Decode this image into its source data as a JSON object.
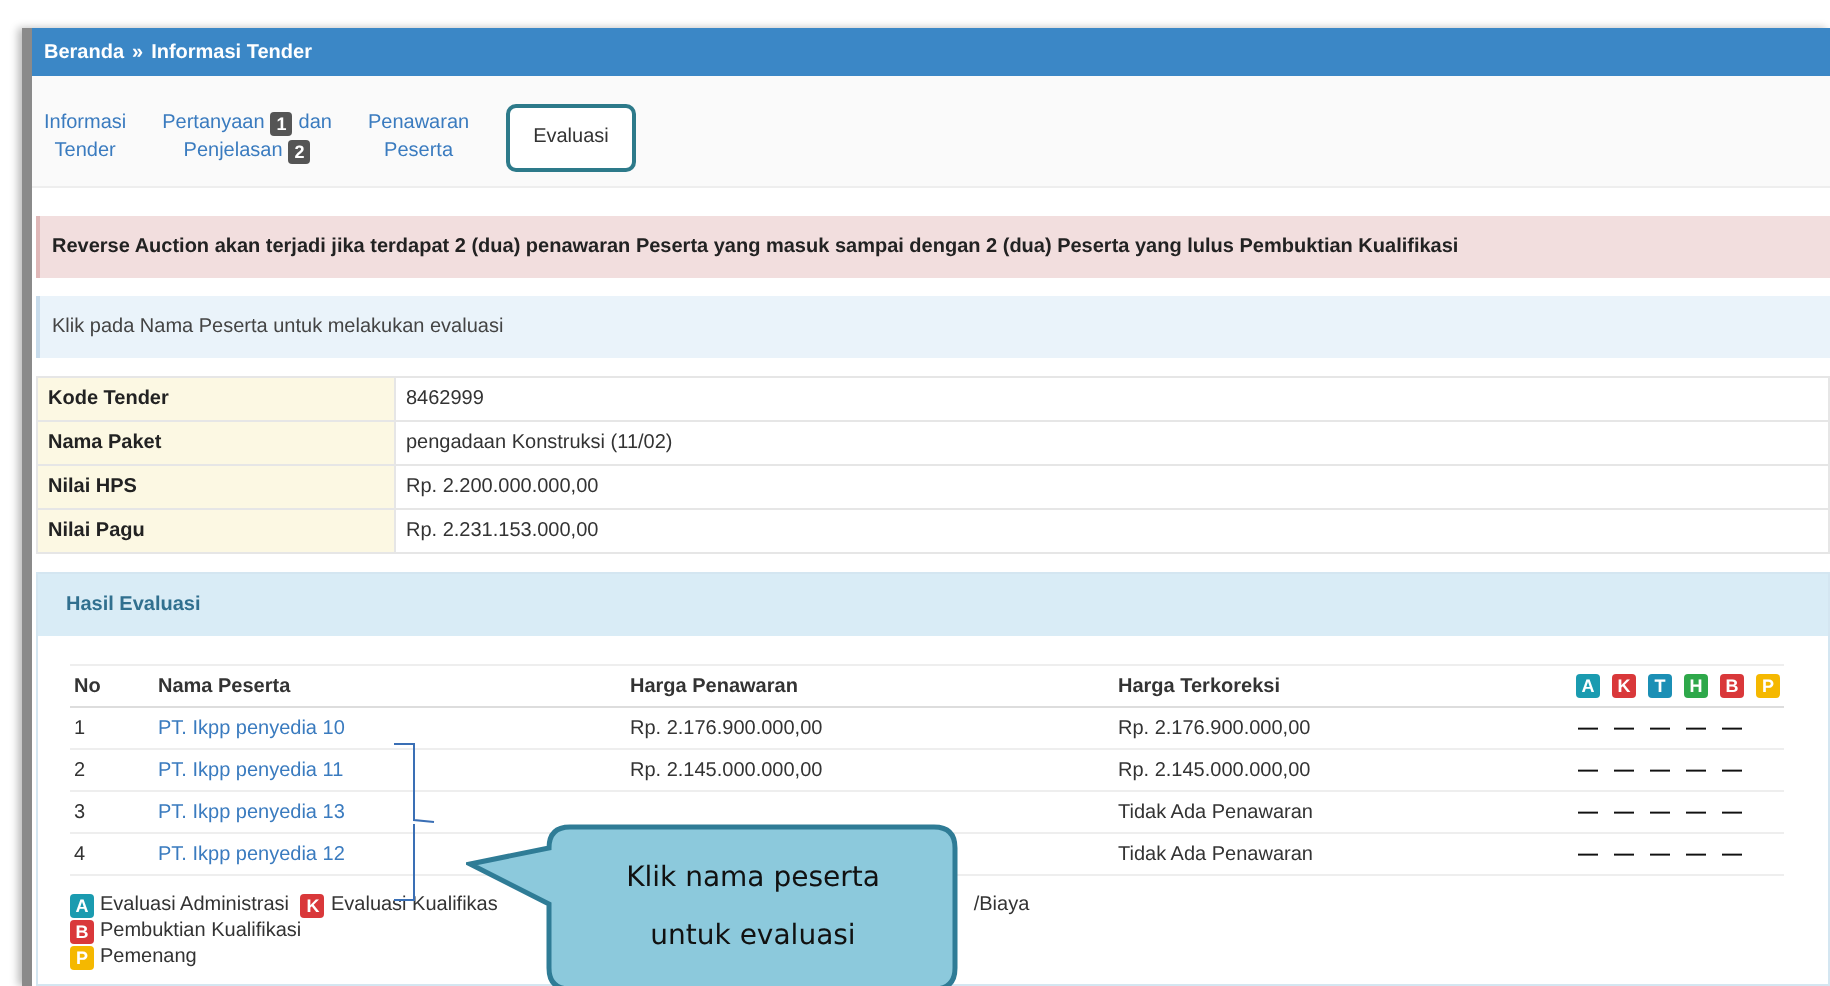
{
  "breadcrumb": {
    "home": "Beranda",
    "separator": "»",
    "current": "Informasi Tender"
  },
  "tabs": [
    {
      "lines": [
        [
          {
            "text": "Informasi"
          }
        ],
        [
          {
            "text": "Tender"
          }
        ]
      ],
      "selected": false
    },
    {
      "lines": [
        [
          {
            "text": "Pertanyaan"
          },
          {
            "badge": "1"
          },
          {
            "text": "dan"
          }
        ],
        [
          {
            "text": "Penjelasan"
          },
          {
            "badge": "2"
          }
        ]
      ],
      "selected": false
    },
    {
      "lines": [
        [
          {
            "text": "Penawaran"
          }
        ],
        [
          {
            "text": "Peserta"
          }
        ]
      ],
      "selected": false
    },
    {
      "lines": [
        [
          {
            "text": "Evaluasi"
          }
        ]
      ],
      "selected": true
    }
  ],
  "alert": "Reverse Auction akan terjadi jika terdapat 2 (dua) penawaran Peserta yang masuk sampai dengan 2 (dua) Peserta yang lulus Pembuktian Kualifikasi",
  "info": "Klik pada Nama Peserta untuk melakukan evaluasi",
  "details": [
    {
      "label": "Kode Tender",
      "value": "8462999"
    },
    {
      "label": "Nama Paket",
      "value": "pengadaan Konstruksi (11/02)"
    },
    {
      "label": "Nilai HPS",
      "value": "Rp. 2.200.000.000,00"
    },
    {
      "label": "Nilai Pagu",
      "value": "Rp. 2.231.153.000,00"
    }
  ],
  "results": {
    "title": "Hasil Evaluasi",
    "columns": [
      "No",
      "Nama Peserta",
      "Harga Penawaran",
      "Harga Terkoreksi"
    ],
    "badges": [
      {
        "letter": "A",
        "color": "#1a9bb0"
      },
      {
        "letter": "K",
        "color": "#d9383a"
      },
      {
        "letter": "T",
        "color": "#1b8fb5"
      },
      {
        "letter": "H",
        "color": "#2ea84a"
      },
      {
        "letter": "B",
        "color": "#d9383a"
      },
      {
        "letter": "P",
        "color": "#f5b800"
      }
    ],
    "rows": [
      {
        "no": "1",
        "name": "PT. Ikpp penyedia 10",
        "offer": "Rp. 2.176.900.000,00",
        "corrected": "Rp. 2.176.900.000,00",
        "marks": [
          "—",
          "—",
          "—",
          "—",
          "—"
        ]
      },
      {
        "no": "2",
        "name": "PT. Ikpp penyedia 11",
        "offer": "Rp. 2.145.000.000,00",
        "corrected": "Rp. 2.145.000.000,00",
        "marks": [
          "—",
          "—",
          "—",
          "—",
          "—"
        ]
      },
      {
        "no": "3",
        "name": "PT. Ikpp penyedia 13",
        "offer": "",
        "corrected": "Tidak Ada Penawaran",
        "marks": [
          "—",
          "—",
          "—",
          "—",
          "—"
        ]
      },
      {
        "no": "4",
        "name": "PT. Ikpp penyedia 12",
        "offer": "",
        "corrected": "Tidak Ada Penawaran",
        "marks": [
          "—",
          "—",
          "—",
          "—",
          "—"
        ]
      }
    ],
    "legend": [
      [
        {
          "badge": "A",
          "color": "#1a9bb0",
          "text": "Evaluasi Administrasi"
        },
        {
          "badge": "K",
          "color": "#d9383a",
          "text": "Evaluasi Kualifikas"
        },
        {
          "text": "/Biaya"
        }
      ],
      [
        {
          "badge": "B",
          "color": "#d9383a",
          "text": "Pembuktian Kualifikasi"
        }
      ],
      [
        {
          "badge": "P",
          "color": "#f5b800",
          "text": "Pemenang"
        }
      ]
    ]
  },
  "callout": [
    "Klik nama peserta",
    "untuk evaluasi"
  ]
}
